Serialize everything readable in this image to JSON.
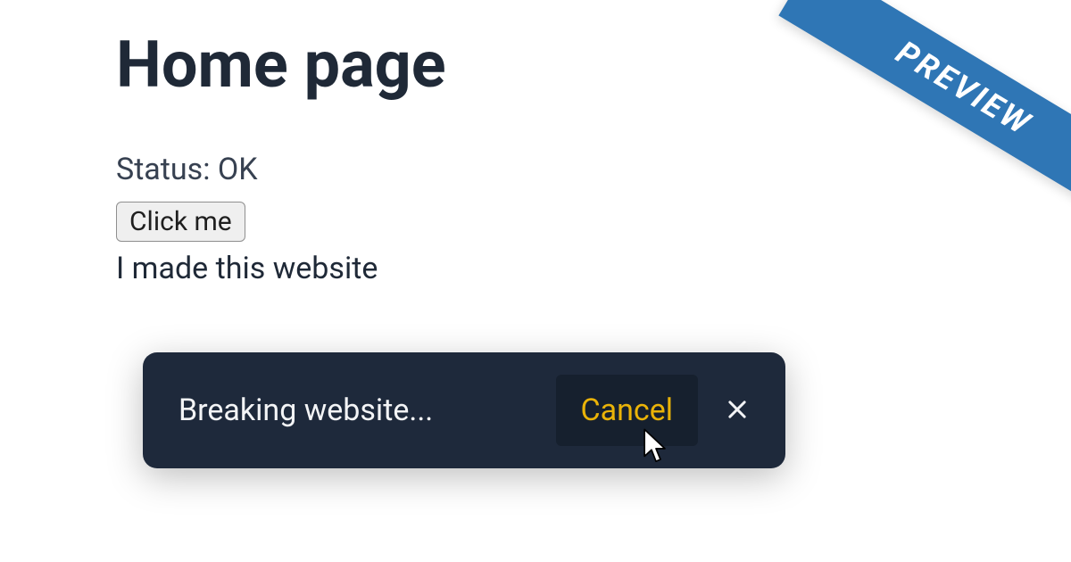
{
  "page": {
    "title": "Home page",
    "status_text": "Status: OK",
    "button_label": "Click me",
    "footer_text": "I made this website"
  },
  "toast": {
    "message": "Breaking website...",
    "cancel_label": "Cancel"
  },
  "ribbon": {
    "label": "PREVIEW"
  }
}
